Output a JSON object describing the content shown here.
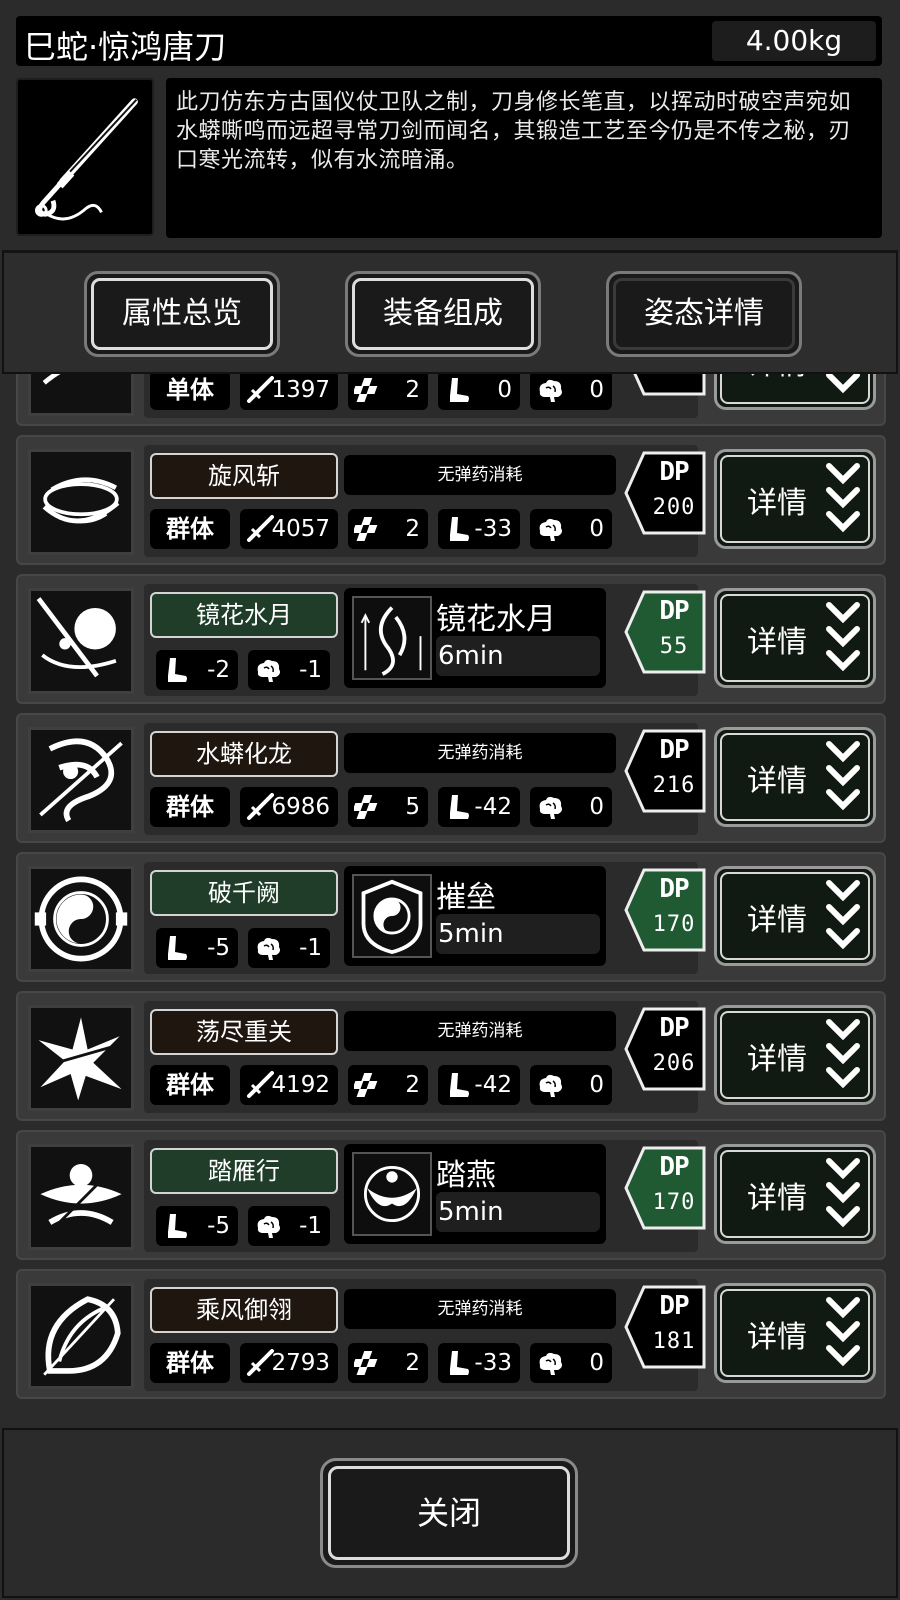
{
  "weapon": {
    "name": "巳蛇·惊鸿唐刀",
    "weight": "4.00kg",
    "description": "此刀仿东方古国仪仗卫队之制，刀身修长笔直，以挥动时破空声宛如水蟒嘶鸣而远超寻常刀剑而闻名，其锻造工艺至今仍是不传之秘，刃口寒光流转，似有水流暗涌。",
    "image_icon": "tang-sword-icon"
  },
  "tabs": [
    {
      "label": "属性总览",
      "selected": true
    },
    {
      "label": "装备组成",
      "selected": true
    },
    {
      "label": "姿态详情",
      "selected": false
    }
  ],
  "skills": [
    {
      "type": "attack",
      "icon": "wave-slash-icon",
      "name": "",
      "target": "单体",
      "damage": "1397",
      "hits": "2",
      "cost": "0",
      "mind": "0",
      "dp_label": "",
      "dp": "",
      "detail": "详情"
    },
    {
      "type": "attack",
      "icon": "whirlwind-icon",
      "name": "旋风斩",
      "ammo": "无弹药消耗",
      "target": "群体",
      "damage": "4057",
      "hits": "2",
      "cost": "-33",
      "mind": "0",
      "dp_label": "DP",
      "dp": "200",
      "detail": "详情"
    },
    {
      "type": "stance",
      "icon": "moon-flower-icon",
      "name": "镜花水月",
      "cost": "-2",
      "mind": "-1",
      "stance_icon": "water-spirit-icon",
      "stance_name": "镜花水月",
      "stance_time": "6min",
      "dp_label": "DP",
      "dp": "55",
      "detail": "详情"
    },
    {
      "type": "attack",
      "icon": "water-dragon-icon",
      "name": "水蟒化龙",
      "ammo": "无弹药消耗",
      "target": "群体",
      "damage": "6986",
      "hits": "5",
      "cost": "-42",
      "mind": "0",
      "dp_label": "DP",
      "dp": "216",
      "detail": "详情"
    },
    {
      "type": "stance",
      "icon": "taiji-shield-icon",
      "name": "破千阙",
      "cost": "-5",
      "mind": "-1",
      "stance_icon": "taiji-badge-icon",
      "stance_name": "摧垒",
      "stance_time": "5min",
      "dp_label": "DP",
      "dp": "170",
      "detail": "详情"
    },
    {
      "type": "attack",
      "icon": "burst-slash-icon",
      "name": "荡尽重关",
      "ammo": "无弹药消耗",
      "target": "群体",
      "damage": "4192",
      "hits": "2",
      "cost": "-42",
      "mind": "0",
      "dp_label": "DP",
      "dp": "206",
      "detail": "详情"
    },
    {
      "type": "stance",
      "icon": "swallow-dance-icon",
      "name": "踏雁行",
      "cost": "-5",
      "mind": "-1",
      "stance_icon": "swallow-badge-icon",
      "stance_name": "踏燕",
      "stance_time": "5min",
      "dp_label": "DP",
      "dp": "170",
      "detail": "详情"
    },
    {
      "type": "attack",
      "icon": "wind-feather-icon",
      "name": "乘风御翎",
      "ammo": "无弹药消耗",
      "target": "群体",
      "damage": "2793",
      "hits": "2",
      "cost": "-33",
      "mind": "0",
      "dp_label": "DP",
      "dp": "181",
      "detail": "详情"
    }
  ],
  "footer": {
    "close_label": "关闭"
  },
  "colors": {
    "stance_green": "#1f3d28",
    "attack_brown": "#1f170f",
    "panel_bg": "#3a3a3a"
  }
}
